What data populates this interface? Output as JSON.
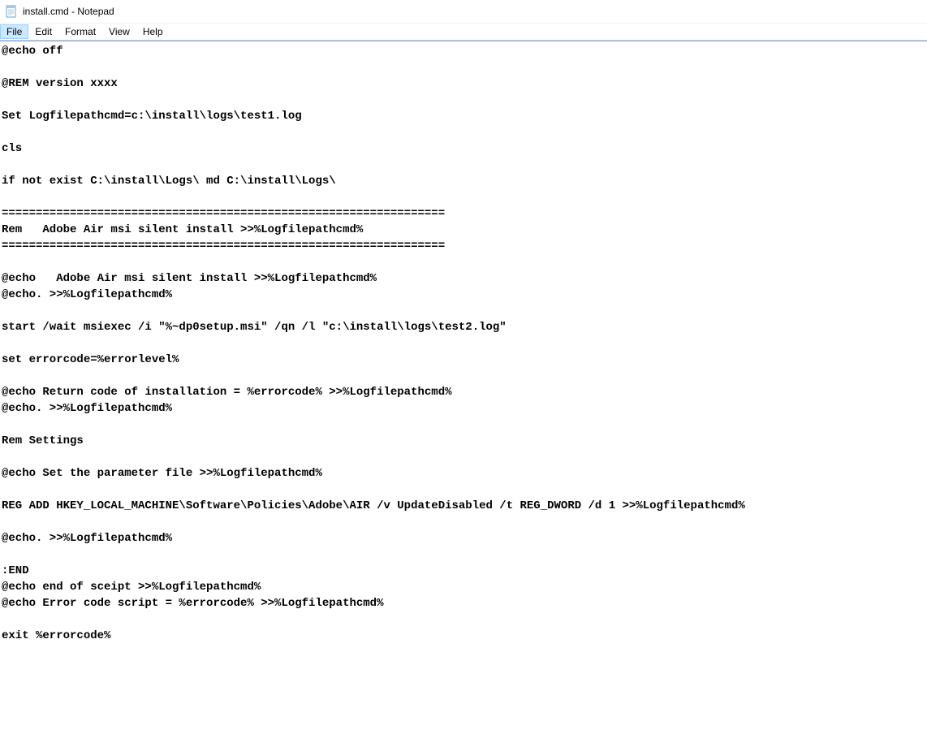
{
  "window": {
    "title": "install.cmd - Notepad"
  },
  "menu": {
    "file": "File",
    "edit": "Edit",
    "format": "Format",
    "view": "View",
    "help": "Help"
  },
  "content": "@echo off\n\n@REM version xxxx\n\nSet Logfilepathcmd=c:\\install\\logs\\test1.log\n\ncls\n\nif not exist C:\\install\\Logs\\ md C:\\install\\Logs\\\n\n=================================================================\nRem   Adobe Air msi silent install >>%Logfilepathcmd%\n=================================================================\n\n@echo   Adobe Air msi silent install >>%Logfilepathcmd%\n@echo. >>%Logfilepathcmd%\n\nstart /wait msiexec /i \"%~dp0setup.msi\" /qn /l \"c:\\install\\logs\\test2.log\"\n\nset errorcode=%errorlevel%\n\n@echo Return code of installation = %errorcode% >>%Logfilepathcmd%\n@echo. >>%Logfilepathcmd%\n\nRem Settings\n\n@echo Set the parameter file >>%Logfilepathcmd%\n\nREG ADD HKEY_LOCAL_MACHINE\\Software\\Policies\\Adobe\\AIR /v UpdateDisabled /t REG_DWORD /d 1 >>%Logfilepathcmd%\n\n@echo. >>%Logfilepathcmd%\n\n:END\n@echo end of sceipt >>%Logfilepathcmd%\n@echo Error code script = %errorcode% >>%Logfilepathcmd%\n\nexit %errorcode%"
}
